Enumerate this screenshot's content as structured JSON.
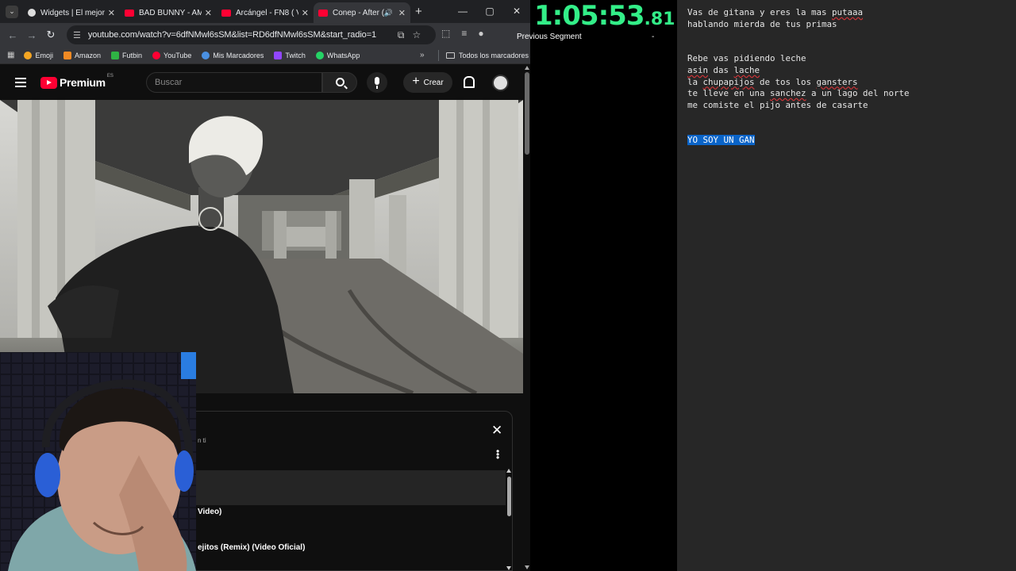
{
  "browser": {
    "tabs": [
      {
        "title": "Widgets | El mejor",
        "favicon": "widgets-icon",
        "active": false
      },
      {
        "title": "BAD BUNNY - AMO",
        "favicon": "youtube-icon",
        "active": false
      },
      {
        "title": "Arcángel - FN8 ( Vi",
        "favicon": "youtube-icon",
        "active": false
      },
      {
        "title": "Conep - After (",
        "favicon": "youtube-icon",
        "active": true
      }
    ],
    "url": "youtube.com/watch?v=6dfNMwl6sSM&list=RD6dfNMwl6sSM&start_radio=1",
    "bookmarks": [
      {
        "label": "Emoji",
        "color": "#f5a623"
      },
      {
        "label": "Amazon",
        "color": "#f08a24"
      },
      {
        "label": "Futbin",
        "color": "#2fb344"
      },
      {
        "label": "YouTube",
        "color": "#ff0033"
      },
      {
        "label": "Mis Marcadores",
        "color": "#4a90e2"
      },
      {
        "label": "Twitch",
        "color": "#9146ff"
      },
      {
        "label": "WhatsApp",
        "color": "#25d366"
      }
    ],
    "all_bookmarks": "Todos los marcadores"
  },
  "youtube": {
    "logo_text": "Premium",
    "country_code": "ES",
    "search_placeholder": "Buscar",
    "create_label": "Crear",
    "playlist": {
      "subtitle_fragment": "n ti",
      "items": [
        {
          "text": "Video)"
        },
        {
          "text": "ejitos (Remix) (Video Oficial)"
        }
      ]
    }
  },
  "timer": {
    "main": "1:05:53",
    "fraction": ".81",
    "segment_label": "Previous Segment",
    "segment_value": "-",
    "color": "#33ee88"
  },
  "notepad": {
    "lines": [
      {
        "text": "Vas de gitana y eres la mas putaaa"
      },
      {
        "text": "hablando mierda de tus primas"
      },
      {
        "text": ""
      },
      {
        "text": ""
      },
      {
        "text": "Rebe vas pidiendo leche"
      },
      {
        "text": "asin das lache"
      },
      {
        "text": "la chupapijos de tos los gansters"
      },
      {
        "text": "te lleve en una sanchez a un lago del norte"
      },
      {
        "text": "me comiste el pijo antes de casarte"
      },
      {
        "text": ""
      },
      {
        "text": ""
      },
      {
        "text": "YO SOY UN GAN"
      }
    ]
  }
}
